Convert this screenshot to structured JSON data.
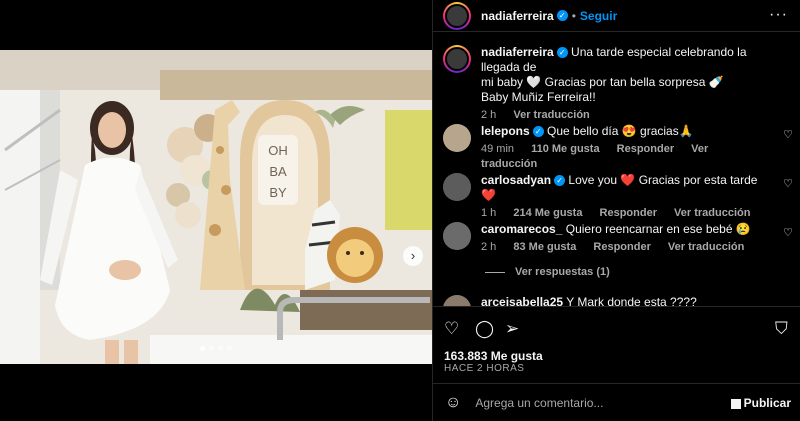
{
  "post": {
    "username": "nadiaferreira",
    "follow_label": "Seguir",
    "caption_line1": "Una tarde especial celebrando la llegada de",
    "caption_line2": "mi baby 🤍 Gracias por tan bella sorpresa 🍼",
    "caption_line3": "Baby Muñiz Ferreira!!",
    "caption_time": "2 h",
    "see_translation": "Ver traducción",
    "photo_sign_text": "OH BA BY"
  },
  "comments": [
    {
      "user": "lelepons",
      "verified": true,
      "text": "Que bello día 😍 gracias🙏",
      "time": "49 min",
      "likes": "110 Me gusta",
      "reply": "Responder",
      "translate": "Ver traducción"
    },
    {
      "user": "carlosadyan",
      "verified": true,
      "text": "Love you ❤️ Gracias por esta tarde ❤️",
      "time": "1 h",
      "likes": "214 Me gusta",
      "reply": "Responder",
      "translate": "Ver traducción"
    },
    {
      "user": "caromarecos_",
      "verified": false,
      "text": "Quiero reencarnar en ese bebé 😢",
      "time": "2 h",
      "likes": "83 Me gusta",
      "reply": "Responder",
      "translate": "Ver traducción"
    },
    {
      "user": "arceisabella25",
      "verified": false,
      "text": "Y Mark donde esta ????",
      "time": "",
      "likes": "",
      "reply": "",
      "translate": ""
    }
  ],
  "view_replies": "Ver respuestas (1)",
  "actions": {
    "likes_count": "163.883 Me gusta",
    "posted_ago": "HACE 2 HORAS"
  },
  "composer": {
    "placeholder": "Agrega un comentario...",
    "publish_label": "Publicar"
  },
  "colors": {
    "background": "#000000",
    "accent": "#0095f6",
    "secondary_text": "#a8a8a8",
    "divider": "#262626"
  },
  "icons": [
    "heart-icon",
    "comment-icon",
    "share-icon",
    "bookmark-icon",
    "emoji-icon",
    "more-options-icon",
    "next-arrow-icon",
    "verified-icon"
  ]
}
